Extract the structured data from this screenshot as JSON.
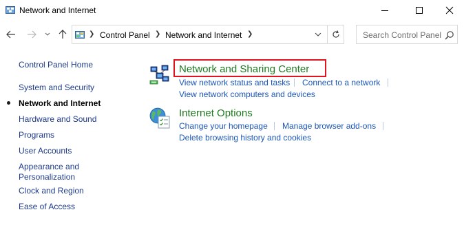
{
  "window": {
    "title": "Network and Internet",
    "controls": {
      "minimize": "minimize-icon",
      "maximize": "maximize-icon",
      "close": "close-icon"
    }
  },
  "navigation": {
    "breadcrumbs": [
      "Control Panel",
      "Network and Internet"
    ],
    "search_placeholder": "Search Control Panel"
  },
  "sidebar": {
    "home": "Control Panel Home",
    "items": [
      {
        "label": "System and Security",
        "active": false
      },
      {
        "label": "Network and Internet",
        "active": true
      },
      {
        "label": "Hardware and Sound",
        "active": false
      },
      {
        "label": "Programs",
        "active": false
      },
      {
        "label": "User Accounts",
        "active": false
      },
      {
        "label": "Appearance and",
        "label2": "Personalization",
        "active": false
      },
      {
        "label": "Clock and Region",
        "active": false
      },
      {
        "label": "Ease of Access",
        "active": false
      }
    ]
  },
  "categories": [
    {
      "title": "Network and Sharing Center",
      "icon": "network-sharing-icon",
      "highlighted": true,
      "tasks": [
        "View network status and tasks",
        "Connect to a network",
        "View network computers and devices"
      ]
    },
    {
      "title": "Internet Options",
      "icon": "internet-options-icon",
      "highlighted": false,
      "tasks": [
        "Change your homepage",
        "Manage browser add-ons",
        "Delete browsing history and cookies"
      ]
    }
  ],
  "colors": {
    "category_title": "#1e7a1e",
    "task_link": "#1a55b8",
    "sidebar_link": "#1e3b8b",
    "highlight_border": "#e0141e"
  }
}
